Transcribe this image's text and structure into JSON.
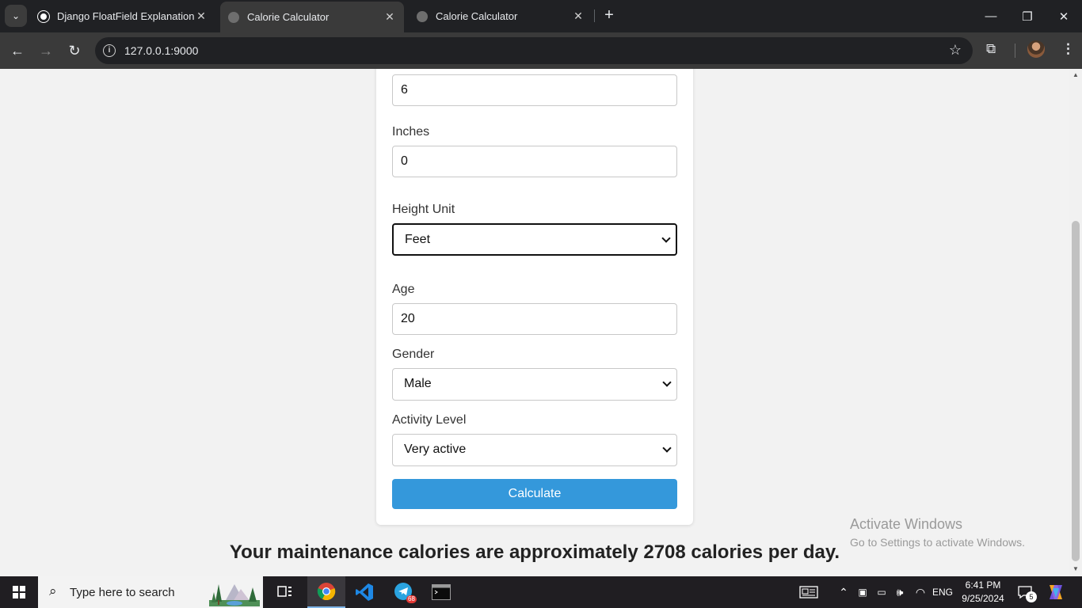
{
  "browser": {
    "tabs": [
      {
        "title": "Django FloatField Explanation",
        "active": false
      },
      {
        "title": "Calorie Calculator",
        "active": true
      },
      {
        "title": "Calorie Calculator",
        "active": false
      }
    ],
    "url": "127.0.0.1:9000"
  },
  "form": {
    "feet_value": "6",
    "inches_label": "Inches",
    "inches_value": "0",
    "height_unit_label": "Height Unit",
    "height_unit_value": "Feet",
    "age_label": "Age",
    "age_value": "20",
    "gender_label": "Gender",
    "gender_value": "Male",
    "activity_label": "Activity Level",
    "activity_value": "Very active",
    "calculate_label": "Calculate"
  },
  "result_text": "Your maintenance calories are approximately 2708 calories per day.",
  "watermark": {
    "line1": "Activate Windows",
    "line2": "Go to Settings to activate Windows."
  },
  "taskbar": {
    "search_placeholder": "Type here to search",
    "telegram_badge": "68",
    "language": "ENG",
    "time": "6:41 PM",
    "date": "9/25/2024",
    "notification_count": "5"
  },
  "colors": {
    "accent_button": "#3498db",
    "page_background": "#f2f2f2",
    "chrome_dark": "#202124"
  }
}
